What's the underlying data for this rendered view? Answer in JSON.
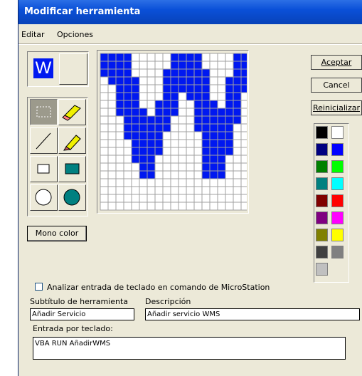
{
  "dialog": {
    "title": "Modificar herramienta"
  },
  "menu": {
    "edit": "Editar",
    "options": "Opciones"
  },
  "buttons": {
    "accept": "Aceptar",
    "cancel": "Cancel",
    "reset": "Reinicializar",
    "mono_color": "Mono color"
  },
  "preview": {
    "glyph": "W"
  },
  "tools": [
    "select-rectangle",
    "eraser",
    "line",
    "pencil",
    "rectangle-outline",
    "rectangle-filled",
    "circle-outline",
    "circle-filled"
  ],
  "icon_pattern": [
    "1111000001111000011",
    "1111000001111000011",
    "1111000011111100011",
    "0111100011111100111",
    "0011100011111100111",
    "0011100011011100110",
    "0011100111001110110",
    "0011110111001111110",
    "0001111110001111110",
    "0001111110001111100",
    "0001111100000111100",
    "0000111100000111100",
    "0000111100000111100",
    "0000111000000111000",
    "0000011000000111000",
    "0000011000000111000",
    "0000000000000000000",
    "0000000000000000000",
    "0000000000000000000",
    "0000000000000000000"
  ],
  "icon_color": "#0018f0",
  "palette": [
    [
      "#000000",
      "#ffffff"
    ],
    [
      "#000080",
      "#0000ff"
    ],
    [
      "#008000",
      "#00ff00"
    ],
    [
      "#008080",
      "#00ffff"
    ],
    [
      "#800000",
      "#ff0000"
    ],
    [
      "#800080",
      "#ff00ff"
    ],
    [
      "#808000",
      "#ffff00"
    ],
    [
      "#404040",
      "#808080"
    ],
    [
      "#c0c0c0"
    ]
  ],
  "keyboard_checkbox": {
    "label": "Analizar entrada de teclado en comando de MicroStation",
    "checked": false
  },
  "fields": {
    "subtitle_label": "Subtítulo de herramienta",
    "subtitle_value": "Añadir Servicio",
    "description_label": "Descripción",
    "description_value": "Añadir servicio WMS",
    "keyin_label": "Entrada por teclado:",
    "keyin_value": "VBA RUN AñadirWMS"
  }
}
